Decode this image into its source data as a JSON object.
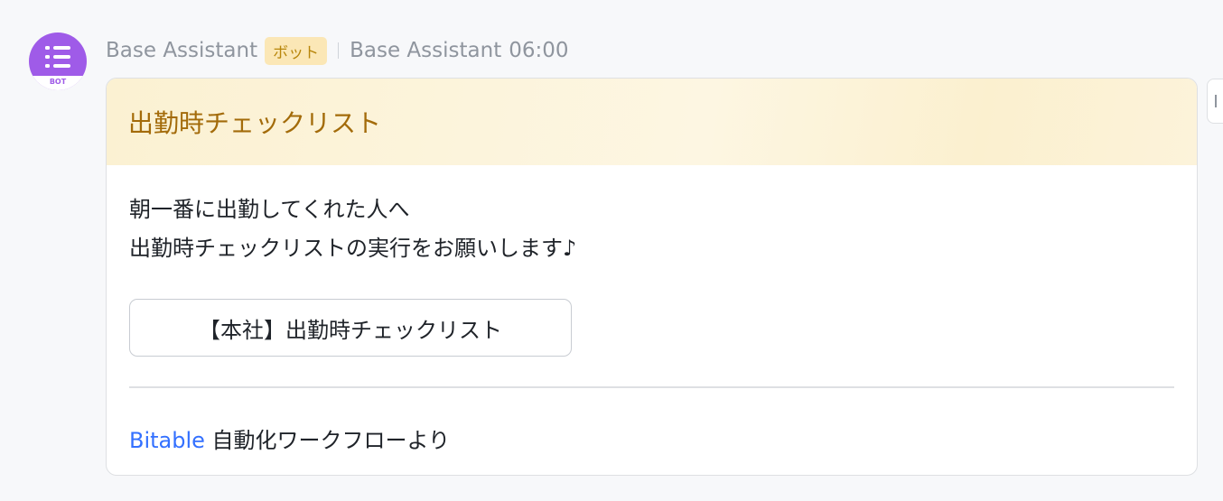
{
  "message": {
    "sender": "Base Assistant",
    "badge": "ボット",
    "sub_sender": "Base Assistant",
    "time": "06:00",
    "avatar_tag": "BOT",
    "avatar_color": "#9f5be8"
  },
  "card": {
    "title": "出勤時チェックリスト",
    "body_line1": "朝一番に出勤してくれた人へ",
    "body_line2": "出勤時チェックリストの実行をお願いします♪",
    "button_label": "【本社】出勤時チェックリスト",
    "footer_link": "Bitable",
    "footer_text": " 自動化ワークフローより",
    "header_title_color": "#a36b0a",
    "link_color": "#3370ff"
  }
}
